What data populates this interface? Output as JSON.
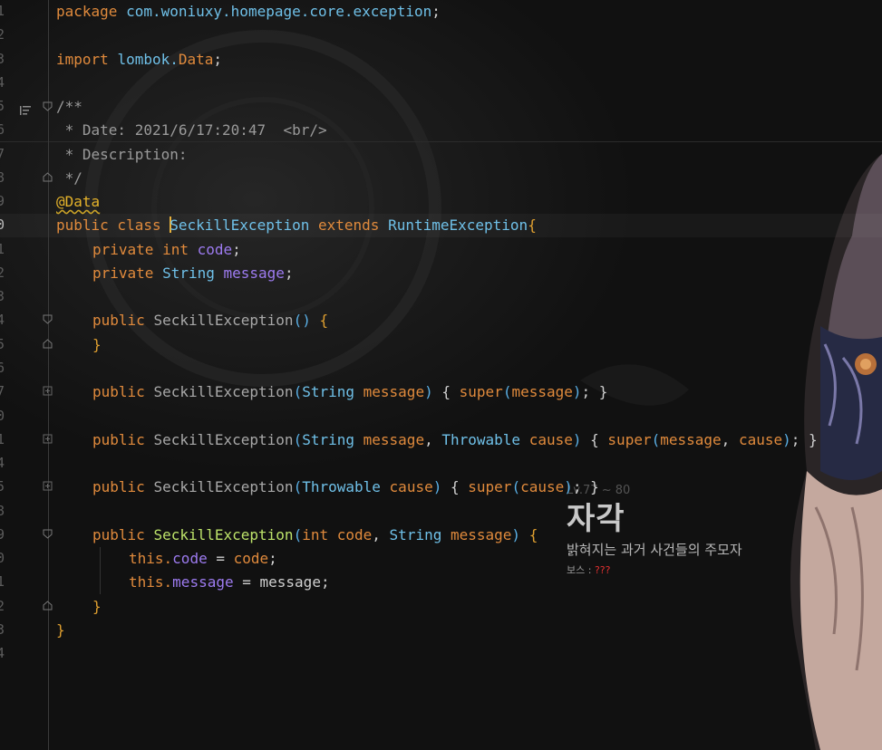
{
  "line_numbers": [
    "1",
    "2",
    "3",
    "4",
    "5",
    "6",
    "7",
    "8",
    "9",
    "0",
    "1",
    "2",
    "3",
    "4",
    "5",
    "6",
    "7",
    "0",
    "1",
    "4",
    "5",
    "8",
    "9",
    "0",
    "1",
    "2",
    "3",
    "4"
  ],
  "code": {
    "l1_kw": "package",
    "l1_pkg": "com.woniuxy.homepage.core.exception",
    "l3_kw": "import",
    "l3_pkg": "lombok.",
    "l3_cls": "Data",
    "l5": "/**",
    "l6": " * Date: 2021/6/17:20:47  <br/>",
    "l7": " * Description:",
    "l8": " */",
    "l9": "@Data",
    "l10_kw": "public class ",
    "l10_name": "SeckillException",
    "l10_ext": " extends ",
    "l10_super": "RuntimeException",
    "l11_kw": "private int ",
    "l11_field": "code",
    "l12_kw": "private ",
    "l12_type": "String ",
    "l12_field": "message",
    "l14_kw": "public ",
    "l14_fn": "SeckillException",
    "l17_kw": "public ",
    "l17_fn": "SeckillException",
    "l17_type": "String",
    "l17_param": "message",
    "l17_super": "super",
    "l17_arg": "message",
    "l19_kw": "public ",
    "l19_fn": "SeckillException",
    "l19_type1": "String",
    "l19_param1": "message",
    "l19_type2": "Throwable",
    "l19_param2": "cause",
    "l19_super": "super",
    "l19_arg1": "message",
    "l19_arg2": "cause",
    "l21_kw": "public ",
    "l21_fn": "SeckillException",
    "l21_type": "Throwable",
    "l21_param": "cause",
    "l21_super": "super",
    "l21_arg": "cause",
    "l23_kw": "public ",
    "l23_fn": "SeckillException",
    "l23_type1": "int",
    "l23_param1": "code",
    "l23_type2": "String",
    "l23_param2": "message",
    "l24_this": "this.",
    "l24_field": "code",
    "l24_val": "code",
    "l25_this": "this.",
    "l25_field": "message",
    "l25_val": "message"
  },
  "wallpaper": {
    "level": "Lv.77 ~ 80",
    "title": "자각",
    "subtitle": "밝혀지는 과거 사건들의 주모자",
    "boss_label": "보스 : ",
    "boss_value": "???"
  },
  "colors": {
    "keyword": "#e08a3c",
    "class": "#6fc0e8",
    "field": "#9d7bf0",
    "annotation": "#e4b22a",
    "comment": "#9a9a9a"
  }
}
